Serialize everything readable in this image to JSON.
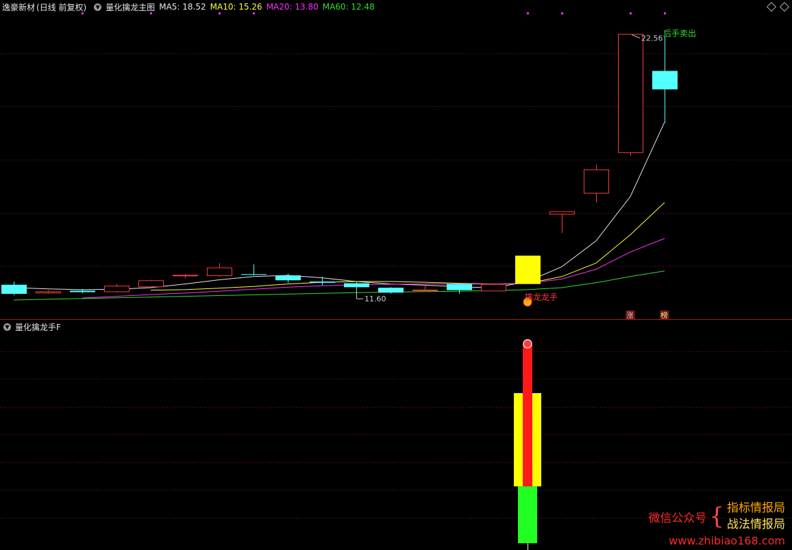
{
  "main_header": {
    "stock_name": "逸豪新材",
    "period_label": "(日线 前复权)",
    "indicator_name": "量化擒龙主图",
    "ma": [
      {
        "label": "MA5: 18.52",
        "color": "#e8e8e8"
      },
      {
        "label": "MA10: 15.26",
        "color": "#ffff40"
      },
      {
        "label": "MA20: 13.80",
        "color": "#ff30ff"
      },
      {
        "label": "MA60: 12.48",
        "color": "#33dd33"
      }
    ]
  },
  "sub_header": {
    "indicator_name": "量化擒龙手F"
  },
  "annotations": {
    "high_price": "22.56",
    "low_price": "11.60",
    "sell_signal": "后手卖出",
    "buy_signal": "擒龙龙手",
    "badge_zhang": "涨",
    "badge_bang": "榜"
  },
  "watermark": {
    "wechat": "微信公众号",
    "name1": "指标情报局",
    "name2": "战法情报局",
    "url": "www.zhibiao168.com"
  },
  "colors": {
    "up": "#ff3b3b",
    "down": "#54ffff",
    "grid": "#8a1a1a",
    "ma5": "#e8e8e8",
    "ma10": "#ffff40",
    "ma20": "#ff30ff",
    "ma60": "#33dd33"
  },
  "chart_data": [
    {
      "type": "candlestick",
      "ylim": [
        10.8,
        23.2
      ],
      "candles": [
        {
          "open": 11.92,
          "high": 12.05,
          "low": 11.5,
          "close": 11.55
        },
        {
          "open": 11.6,
          "high": 11.7,
          "low": 11.55,
          "close": 11.65
        },
        {
          "open": 11.68,
          "high": 11.75,
          "low": 11.58,
          "close": 11.62
        },
        {
          "open": 11.65,
          "high": 11.95,
          "low": 11.6,
          "close": 11.88
        },
        {
          "open": 11.85,
          "high": 12.12,
          "low": 11.82,
          "close": 12.1
        },
        {
          "open": 12.3,
          "high": 12.35,
          "low": 12.18,
          "close": 12.32
        },
        {
          "open": 12.3,
          "high": 12.8,
          "low": 12.25,
          "close": 12.62
        },
        {
          "open": 12.35,
          "high": 12.75,
          "low": 12.3,
          "close": 12.32
        },
        {
          "open": 12.3,
          "high": 12.36,
          "low": 12.0,
          "close": 12.1
        },
        {
          "open": 12.05,
          "high": 12.25,
          "low": 11.9,
          "close": 12.0
        },
        {
          "open": 11.98,
          "high": 12.05,
          "low": 11.6,
          "close": 11.82
        },
        {
          "open": 11.8,
          "high": 11.82,
          "low": 11.55,
          "close": 11.6
        },
        {
          "open": 11.72,
          "high": 11.9,
          "low": 11.68,
          "close": 11.72
        },
        {
          "open": 11.95,
          "high": 11.98,
          "low": 11.55,
          "close": 11.7
        },
        {
          "open": 11.68,
          "high": 11.98,
          "low": 11.65,
          "close": 11.95
        },
        {
          "open": 13.1,
          "high": 13.1,
          "low": 11.95,
          "close": 11.95
        },
        {
          "open": 14.8,
          "high": 14.8,
          "low": 14.02,
          "close": 14.9
        },
        {
          "open": 15.65,
          "high": 16.8,
          "low": 15.25,
          "close": 16.6
        },
        {
          "open": 17.3,
          "high": 17.3,
          "low": 17.15,
          "close": 22.1
        },
        {
          "open": 20.6,
          "high": 22.0,
          "low": 18.5,
          "close": 19.85
        }
      ],
      "ma_series": [
        {
          "name": "MA5",
          "values": [
            11.8,
            11.75,
            11.72,
            11.74,
            11.8,
            11.95,
            12.12,
            12.25,
            12.3,
            12.2,
            12.05,
            11.95,
            11.9,
            11.84,
            11.79,
            12.05,
            12.65,
            13.7,
            15.5,
            18.52
          ]
        },
        {
          "name": "MA10",
          "values": [
            null,
            null,
            null,
            null,
            11.7,
            11.72,
            11.78,
            11.85,
            11.95,
            12.02,
            12.05,
            12.05,
            12.02,
            11.98,
            11.95,
            11.97,
            12.25,
            12.8,
            13.95,
            15.26
          ]
        },
        {
          "name": "MA20",
          "values": [
            null,
            null,
            11.38,
            11.45,
            11.52,
            11.58,
            11.66,
            11.74,
            11.82,
            11.88,
            11.92,
            11.94,
            11.95,
            11.95,
            11.95,
            11.98,
            12.15,
            12.55,
            13.25,
            13.8
          ]
        },
        {
          "name": "MA60",
          "values": [
            11.3,
            11.33,
            11.36,
            11.39,
            11.42,
            11.45,
            11.48,
            11.51,
            11.54,
            11.57,
            11.6,
            11.62,
            11.64,
            11.66,
            11.68,
            11.72,
            11.8,
            12.0,
            12.25,
            12.48
          ]
        }
      ]
    },
    {
      "type": "bar",
      "ylim": [
        0,
        100
      ],
      "bars": [
        {
          "index": 15,
          "color": "#ffff00",
          "from": 28,
          "to": 74
        },
        {
          "index": 15,
          "color": "#ff1a1a",
          "from": 28,
          "to": 98
        },
        {
          "index": 15,
          "color": "#22ff22",
          "from": 0,
          "to": 28
        }
      ]
    }
  ]
}
